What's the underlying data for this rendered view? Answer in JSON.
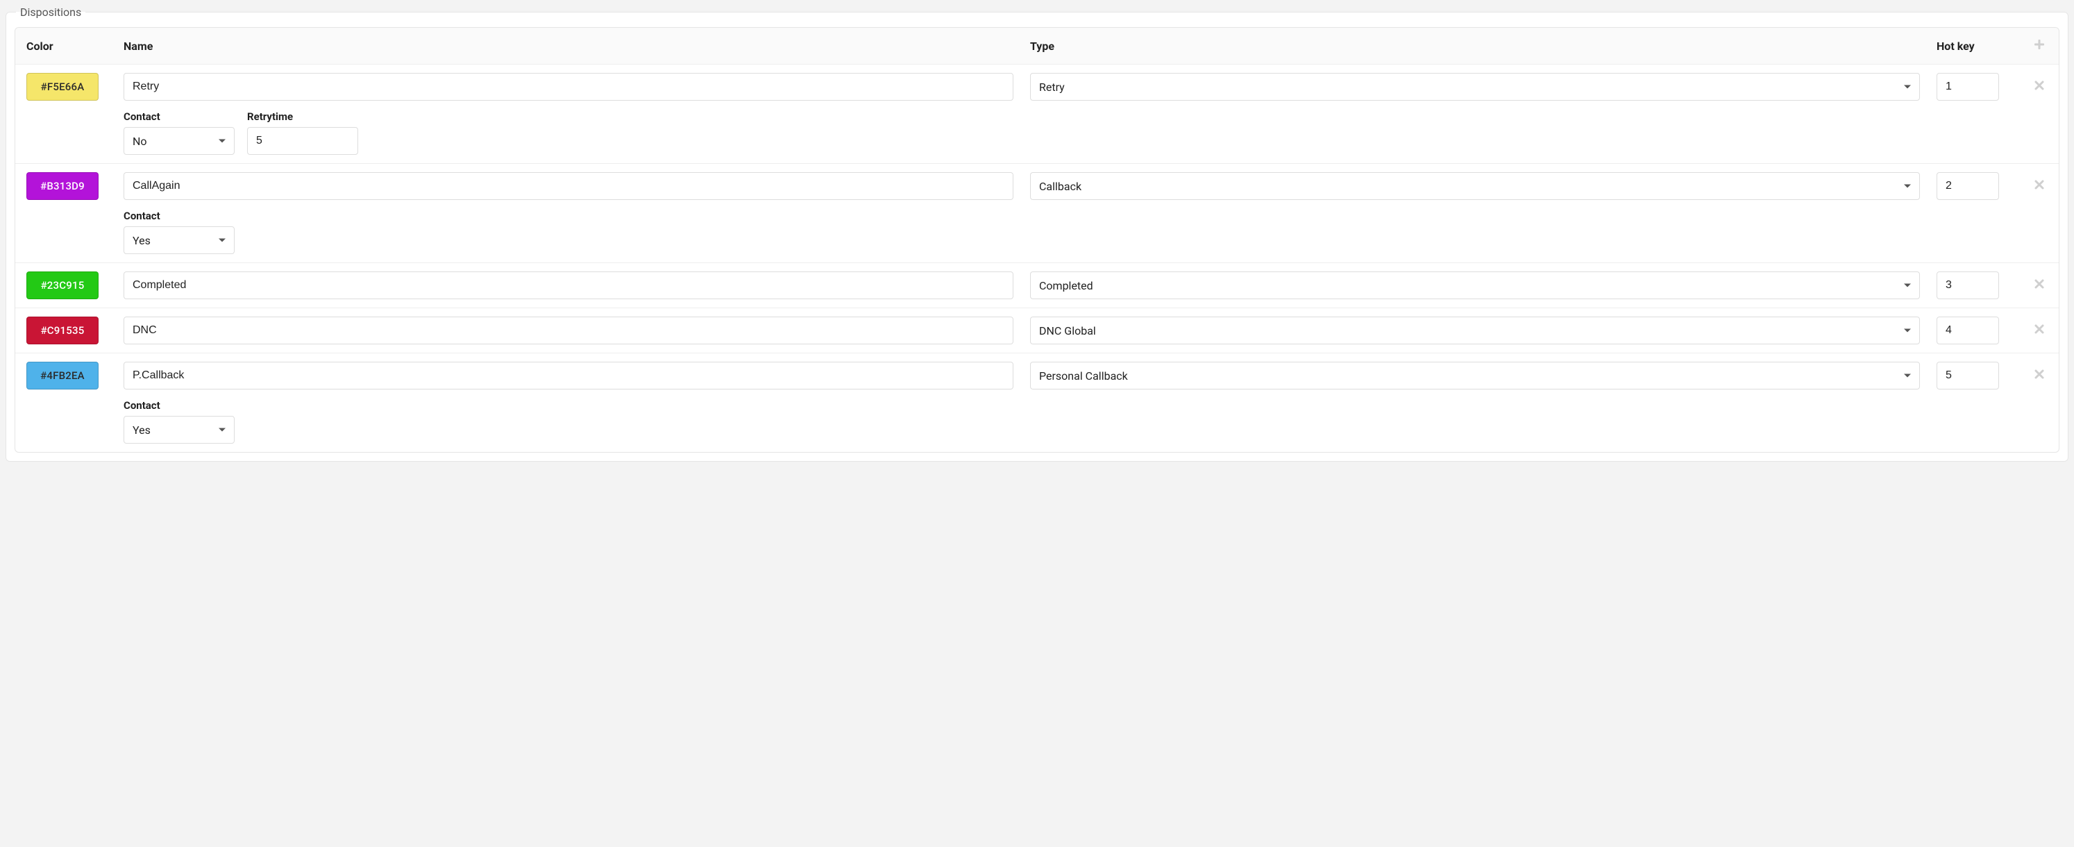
{
  "panel": {
    "legend": "Dispositions"
  },
  "headers": {
    "color": "Color",
    "name": "Name",
    "type": "Type",
    "hotkey": "Hot key"
  },
  "labels": {
    "contact": "Contact",
    "retrytime": "Retrytime"
  },
  "colors": {
    "row0": "#F5E66A",
    "row1": "#B313D9",
    "row2": "#23C915",
    "row3": "#C91535",
    "row4": "#4FB2EA"
  },
  "rows": [
    {
      "color_label": "#F5E66A",
      "name": "Retry",
      "type": "Retry",
      "hotkey": "1",
      "contact": "No",
      "retrytime": "5"
    },
    {
      "color_label": "#B313D9",
      "name": "CallAgain",
      "type": "Callback",
      "hotkey": "2",
      "contact": "Yes"
    },
    {
      "color_label": "#23C915",
      "name": "Completed",
      "type": "Completed",
      "hotkey": "3"
    },
    {
      "color_label": "#C91535",
      "name": "DNC",
      "type": "DNC Global",
      "hotkey": "4"
    },
    {
      "color_label": "#4FB2EA",
      "name": "P.Callback",
      "type": "Personal Callback",
      "hotkey": "5",
      "contact": "Yes"
    }
  ]
}
